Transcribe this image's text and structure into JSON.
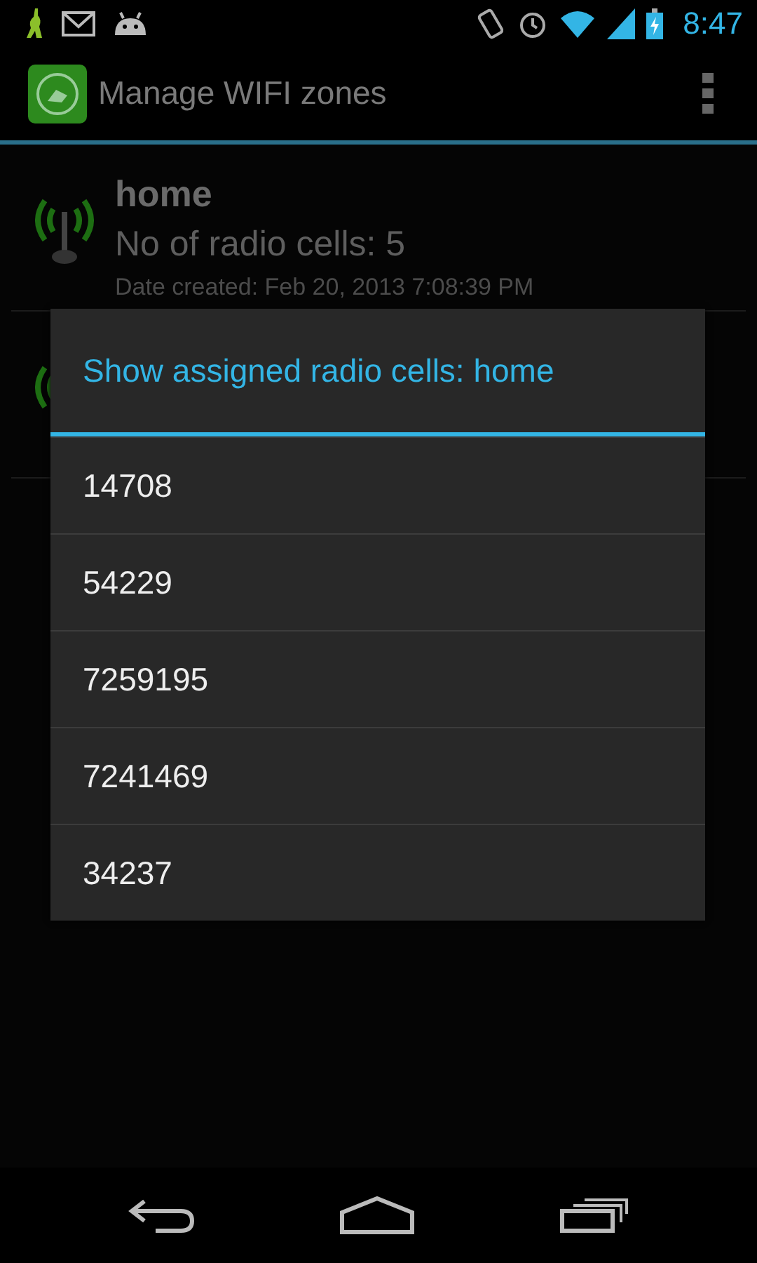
{
  "status_bar": {
    "time": "8:47"
  },
  "action_bar": {
    "title": "Manage WIFI zones"
  },
  "zones": [
    {
      "name": "home",
      "cells": "No of radio cells: 5",
      "date": "Date created: Feb 20, 2013 7:08:39 PM"
    }
  ],
  "dialog": {
    "title": "Show assigned radio cells: home",
    "items": [
      "14708",
      "54229",
      "7259195",
      "7241469",
      "34237"
    ]
  }
}
